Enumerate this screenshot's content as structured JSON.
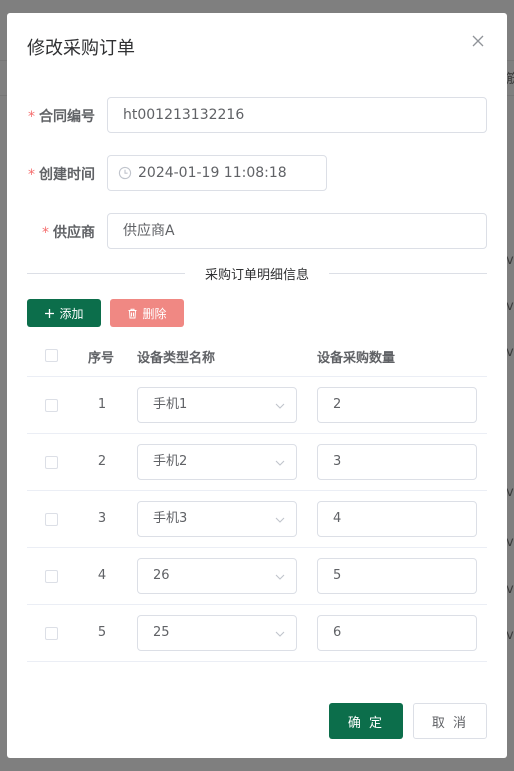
{
  "dialog": {
    "title": "修改采购订单"
  },
  "form": {
    "contract_label": "合同编号",
    "contract_value": "ht001213132216",
    "created_label": "创建时间",
    "created_value": "2024-01-19 11:08:18",
    "supplier_label": "供应商",
    "supplier_value": "供应商A",
    "required_mark": "*"
  },
  "details": {
    "section_title": "采购订单明细信息",
    "add_label": "添加",
    "delete_label": "删除",
    "columns": {
      "index": "序号",
      "type_name": "设备类型名称",
      "quantity": "设备采购数量"
    },
    "rows": [
      {
        "index": "1",
        "type_name": "手机1",
        "quantity": "2"
      },
      {
        "index": "2",
        "type_name": "手机2",
        "quantity": "3"
      },
      {
        "index": "3",
        "type_name": "手机3",
        "quantity": "4"
      },
      {
        "index": "4",
        "type_name": "26",
        "quantity": "5"
      },
      {
        "index": "5",
        "type_name": "25",
        "quantity": "6"
      }
    ]
  },
  "footer": {
    "ok_label": "确 定",
    "cancel_label": "取 消"
  },
  "background": {
    "partial_chars": [
      "筋",
      "ve",
      "ve",
      "ve",
      "ve",
      "ve",
      "ve",
      "ve"
    ]
  },
  "colors": {
    "primary": "#0c6e4b",
    "danger_light": "#f08883",
    "required": "#f56c6c",
    "overlay": "#7f7f7f"
  }
}
